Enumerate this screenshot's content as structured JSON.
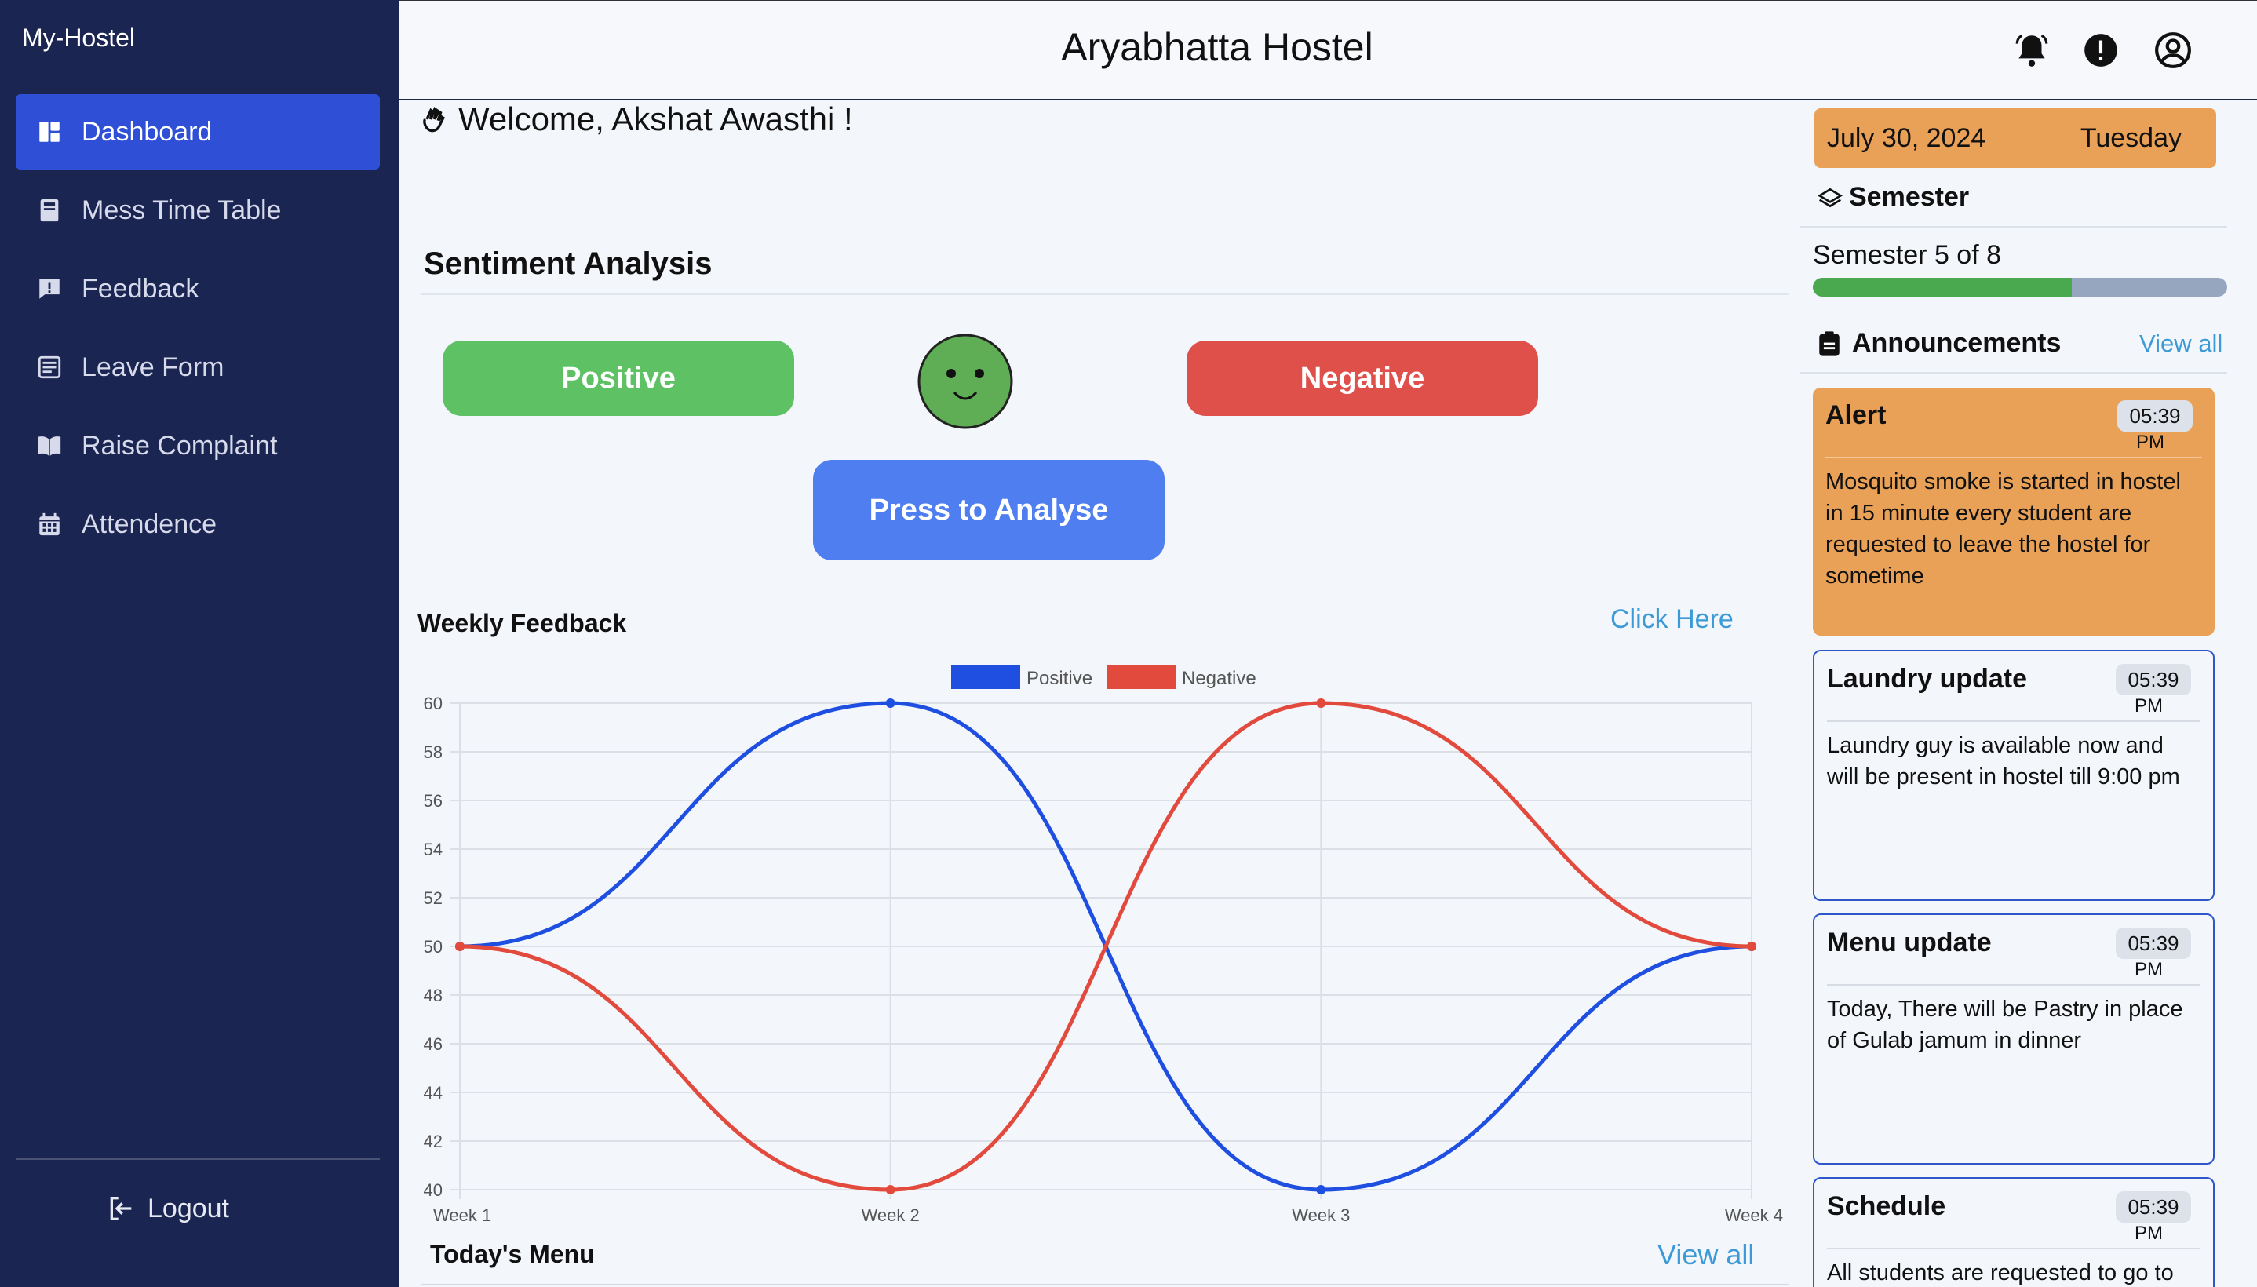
{
  "app": {
    "brand": "My-Hostel",
    "hostel_name": "Aryabhatta Hostel"
  },
  "sidebar": {
    "items": [
      {
        "label": "Dashboard",
        "icon": "dashboard-icon",
        "active": true
      },
      {
        "label": "Mess Time Table",
        "icon": "book-icon"
      },
      {
        "label": "Feedback",
        "icon": "feedback-icon"
      },
      {
        "label": "Leave Form",
        "icon": "form-icon"
      },
      {
        "label": "Raise Complaint",
        "icon": "open-book-icon"
      },
      {
        "label": "Attendence",
        "icon": "calendar-icon"
      }
    ],
    "logout_label": "Logout"
  },
  "header": {
    "icons": [
      "bell-icon",
      "alert-circle-icon",
      "user-circle-icon"
    ]
  },
  "main": {
    "welcome": "Welcome, Akshat Awasthi !",
    "sentiment": {
      "title": "Sentiment Analysis",
      "positive_label": "Positive",
      "negative_label": "Negative",
      "analyse_label": "Press to Analyse"
    },
    "weekly": {
      "title": "Weekly Feedback",
      "link": "Click Here"
    },
    "menu": {
      "title": "Today's Menu",
      "link": "View all"
    }
  },
  "right": {
    "date": "July 30, 2024",
    "day": "Tuesday",
    "semester_heading": "Semester",
    "semester_text": "Semester 5 of 8",
    "semester_progress": 0.625,
    "announcements_heading": "Announcements",
    "announcements_viewall": "View all",
    "announcements": [
      {
        "title": "Alert",
        "time": "05:39",
        "period": "PM",
        "body": "Mosquito smoke is started in hostel in 15 minute every student are requested to leave the hostel for sometime"
      },
      {
        "title": "Laundry update",
        "time": "05:39",
        "period": "PM",
        "body": "Laundry guy is available now and will be present in hostel till 9:00 pm"
      },
      {
        "title": "Menu update",
        "time": "05:39",
        "period": "PM",
        "body": "Today, There will be Pastry in place of Gulab jamum in dinner"
      },
      {
        "title": "Schedule",
        "time": "05:39",
        "period": "PM",
        "body": "All students are requested to go to"
      }
    ]
  },
  "colors": {
    "sidebar": "#1b2552",
    "active": "#2f4fd6",
    "positive": "#1f4fe0",
    "negative": "#e24a3d",
    "accent": "#e9a158"
  },
  "chart_data": {
    "type": "line",
    "categories": [
      "Week 1",
      "Week 2",
      "Week 3",
      "Week 4"
    ],
    "series": [
      {
        "name": "Positive",
        "values": [
          50,
          60,
          40,
          50
        ],
        "color": "#1f4fe0"
      },
      {
        "name": "Negative",
        "values": [
          50,
          40,
          60,
          50
        ],
        "color": "#e24a3d"
      }
    ],
    "ylim": [
      40,
      60
    ],
    "yticks": [
      40,
      42,
      44,
      46,
      48,
      50,
      52,
      54,
      56,
      58,
      60
    ],
    "grid": true,
    "legend": "top"
  }
}
